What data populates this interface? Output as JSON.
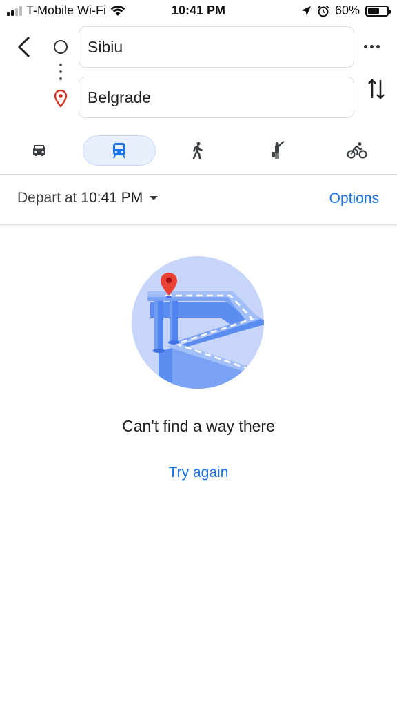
{
  "status_bar": {
    "carrier": "T-Mobile Wi-Fi",
    "time": "10:41 PM",
    "battery": "60%",
    "battery_level": 0.6
  },
  "route": {
    "origin": "Sibiu",
    "destination": "Belgrade"
  },
  "modes": [
    {
      "name": "driving",
      "icon": "car-icon",
      "active": false
    },
    {
      "name": "transit",
      "icon": "train-icon",
      "active": true
    },
    {
      "name": "walking",
      "icon": "walk-icon",
      "active": false
    },
    {
      "name": "ride",
      "icon": "ride-hail-icon",
      "active": false
    },
    {
      "name": "cycling",
      "icon": "bike-icon",
      "active": false
    }
  ],
  "depart": {
    "label": "Depart at",
    "time": "10:41 PM"
  },
  "options_label": "Options",
  "empty_state": {
    "message": "Can't find a way there",
    "retry_label": "Try again"
  },
  "colors": {
    "accent": "#1a73e8",
    "active_mode_bg": "#e8f0fe",
    "pin_red": "#d93025"
  }
}
